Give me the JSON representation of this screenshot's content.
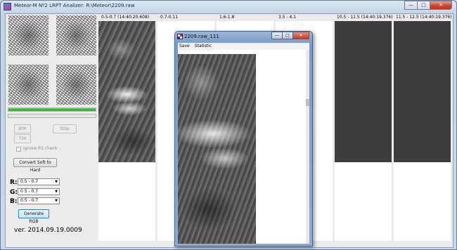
{
  "window": {
    "title": "Meteor-M Nº2 LRPT Analizer: R:\\Meteor\\2209.raw",
    "controls": {
      "minimize": "—",
      "maximize": "□",
      "close": "✕"
    }
  },
  "left_panel": {
    "progress": [
      1.0,
      0.0
    ],
    "buttons": {
      "ok_label": "80K",
      "stop_label": "Stop",
      "k72_label": "72K",
      "convert_label": "Convert Soft to Hard",
      "generate_label": "Generate RGB"
    },
    "ignore_rs_label": "Ignore RS check",
    "rgb": [
      {
        "label": "R:",
        "value": "0.5 - 0.7"
      },
      {
        "label": "G:",
        "value": "0.5 - 0.7"
      },
      {
        "label": "B:",
        "value": "0.5 - 0.7"
      }
    ],
    "version": "ver. 2014.09.19.0009"
  },
  "channels": [
    {
      "label": "0.5-0.7 (14:40:20.608)"
    },
    {
      "label": "0.7-0.11"
    },
    {
      "label": "1.6-1.8"
    },
    {
      "label": "3.5 - 4.1"
    },
    {
      "label": "10.5 - 11.5 (14:40:19.376)"
    },
    {
      "label": "11.5 - 12.5 (14:40:19.376)"
    }
  ],
  "child_window": {
    "title": "2209.raw_111",
    "menu": [
      "Save",
      "Statistic"
    ],
    "controls": {
      "minimize": "—",
      "maximize": "□",
      "close": "✕"
    }
  },
  "colors": {
    "progress_green": "#24b024",
    "accent_blue": "#3c7fb1",
    "titlebar": "#c2d3e7"
  }
}
